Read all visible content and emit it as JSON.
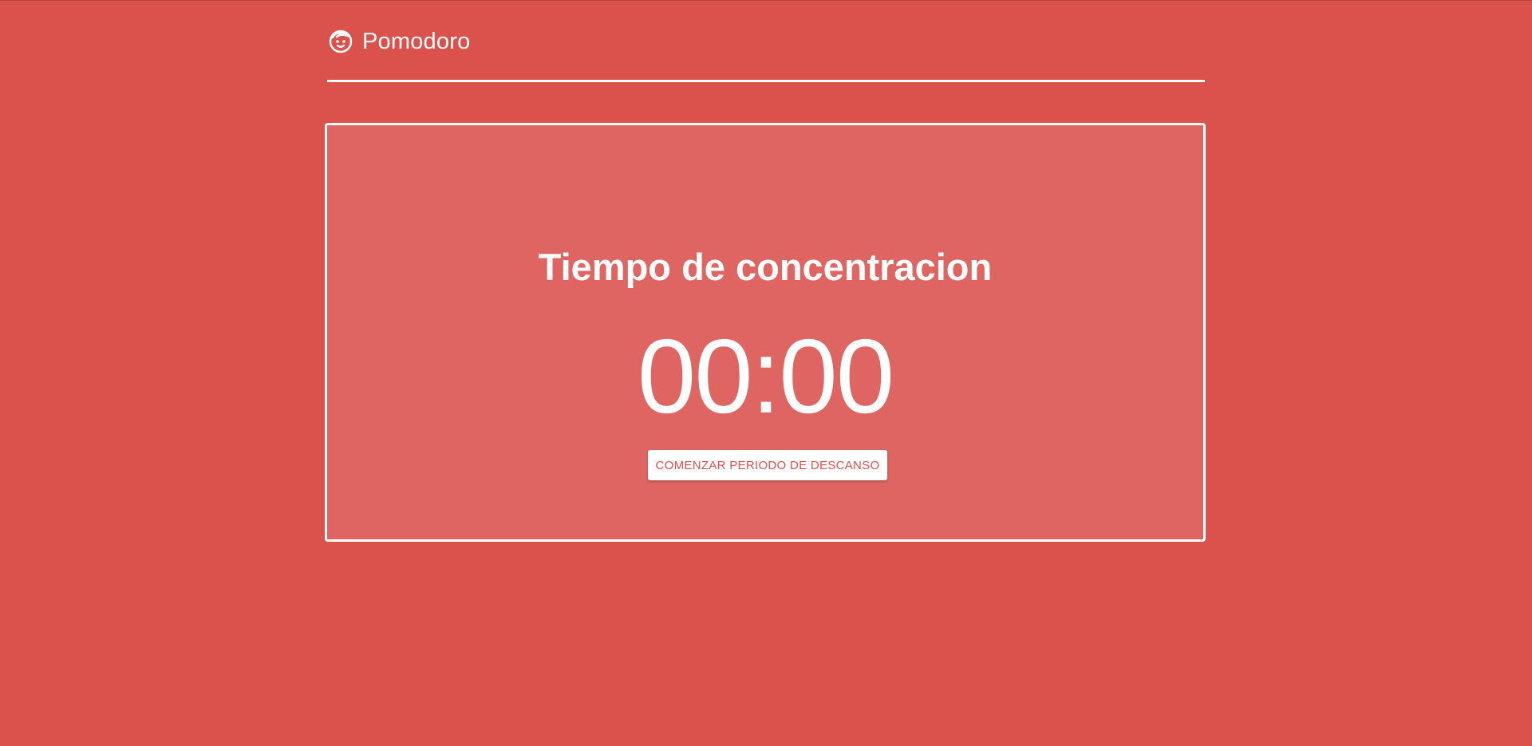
{
  "header": {
    "app_title": "Pomodoro",
    "icon": "baby-face-icon"
  },
  "timer_card": {
    "mode_title": "Tiempo de concentracion",
    "time": "00:00",
    "action_label": "COMENZAR PERIODO DE DESCANSO"
  },
  "colors": {
    "background": "#db524d",
    "card": "#df6562",
    "foreground": "#ffffff"
  }
}
